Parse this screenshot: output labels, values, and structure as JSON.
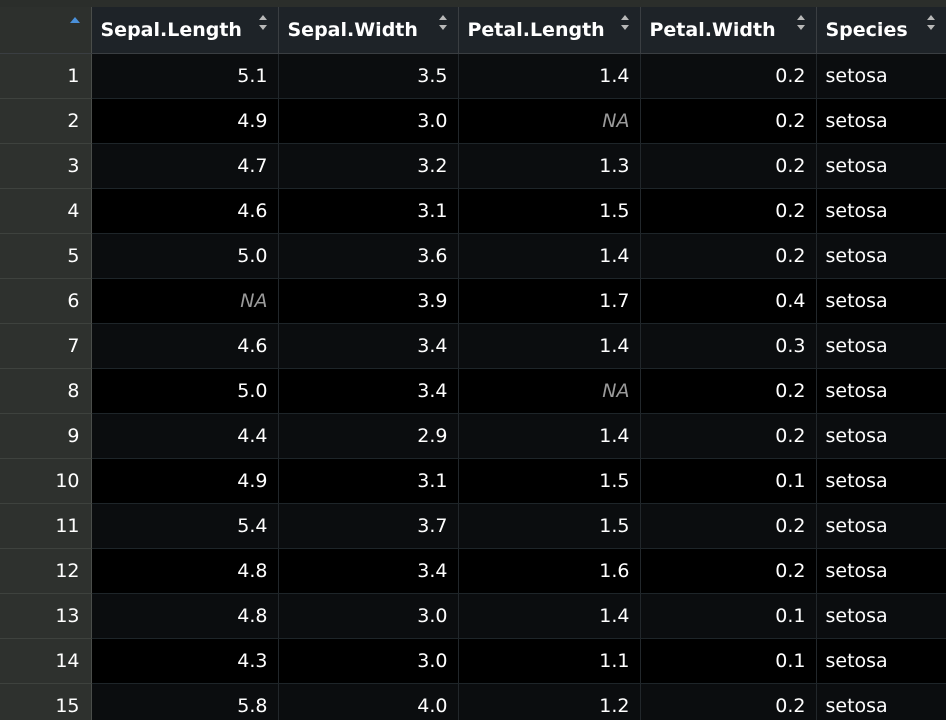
{
  "colors": {
    "header_bg": "#1e2328",
    "rowname_bg": "#2e312e",
    "row_odd_bg": "#0b0d0f",
    "row_even_bg": "#000000",
    "na_text": "#9a9a9a",
    "sort_active": "#4a90d9",
    "sort_inactive": "#b8b8b8"
  },
  "table": {
    "rowname_header": "",
    "rowname_sort_icon": "sort-ascending-icon",
    "columns": [
      {
        "label": "Sepal.Length",
        "align": "right",
        "sort_icon": "sort-icon"
      },
      {
        "label": "Sepal.Width",
        "align": "right",
        "sort_icon": "sort-icon"
      },
      {
        "label": "Petal.Length",
        "align": "right",
        "sort_icon": "sort-icon"
      },
      {
        "label": "Petal.Width",
        "align": "right",
        "sort_icon": "sort-icon"
      },
      {
        "label": "Species",
        "align": "left",
        "sort_icon": "sort-icon"
      }
    ],
    "rows": [
      {
        "id": "1",
        "cells": [
          "5.1",
          "3.5",
          "1.4",
          "0.2",
          "setosa"
        ]
      },
      {
        "id": "2",
        "cells": [
          "4.9",
          "3.0",
          "NA",
          "0.2",
          "setosa"
        ]
      },
      {
        "id": "3",
        "cells": [
          "4.7",
          "3.2",
          "1.3",
          "0.2",
          "setosa"
        ]
      },
      {
        "id": "4",
        "cells": [
          "4.6",
          "3.1",
          "1.5",
          "0.2",
          "setosa"
        ]
      },
      {
        "id": "5",
        "cells": [
          "5.0",
          "3.6",
          "1.4",
          "0.2",
          "setosa"
        ]
      },
      {
        "id": "6",
        "cells": [
          "NA",
          "3.9",
          "1.7",
          "0.4",
          "setosa"
        ]
      },
      {
        "id": "7",
        "cells": [
          "4.6",
          "3.4",
          "1.4",
          "0.3",
          "setosa"
        ]
      },
      {
        "id": "8",
        "cells": [
          "5.0",
          "3.4",
          "NA",
          "0.2",
          "setosa"
        ]
      },
      {
        "id": "9",
        "cells": [
          "4.4",
          "2.9",
          "1.4",
          "0.2",
          "setosa"
        ]
      },
      {
        "id": "10",
        "cells": [
          "4.9",
          "3.1",
          "1.5",
          "0.1",
          "setosa"
        ]
      },
      {
        "id": "11",
        "cells": [
          "5.4",
          "3.7",
          "1.5",
          "0.2",
          "setosa"
        ]
      },
      {
        "id": "12",
        "cells": [
          "4.8",
          "3.4",
          "1.6",
          "0.2",
          "setosa"
        ]
      },
      {
        "id": "13",
        "cells": [
          "4.8",
          "3.0",
          "1.4",
          "0.1",
          "setosa"
        ]
      },
      {
        "id": "14",
        "cells": [
          "4.3",
          "3.0",
          "1.1",
          "0.1",
          "setosa"
        ]
      },
      {
        "id": "15",
        "cells": [
          "5.8",
          "4.0",
          "1.2",
          "0.2",
          "setosa"
        ]
      }
    ]
  }
}
